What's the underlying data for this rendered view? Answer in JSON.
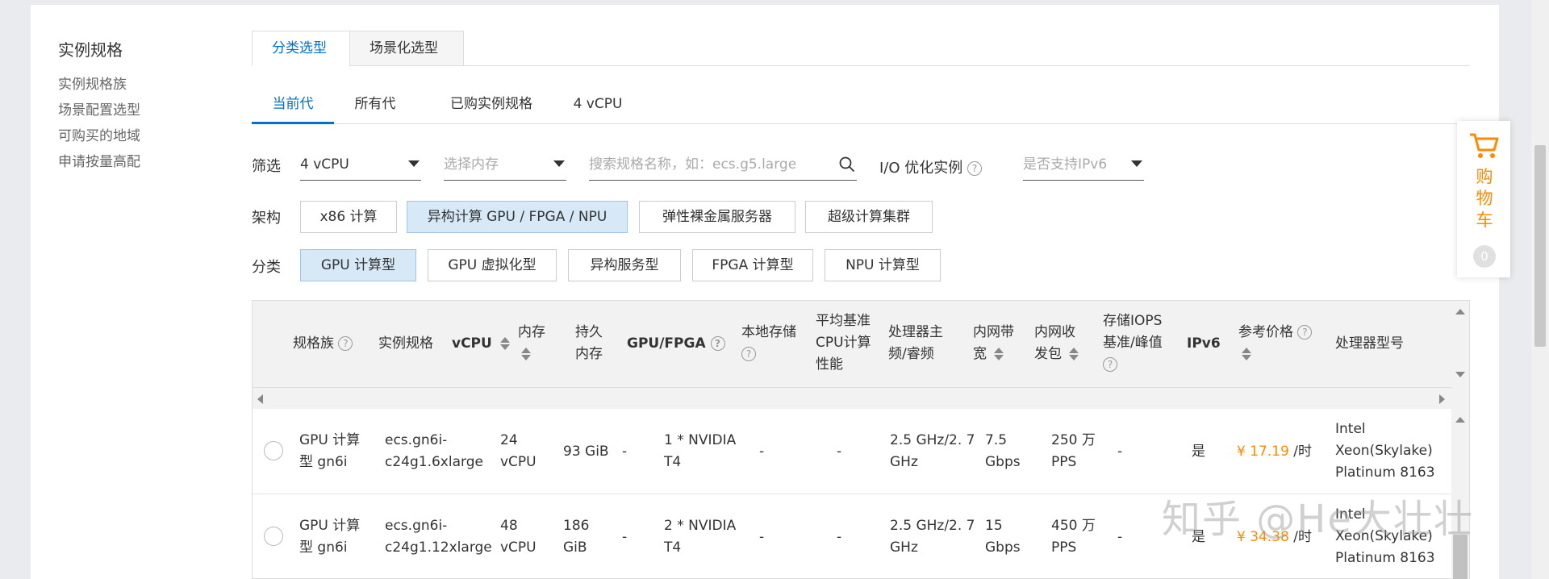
{
  "leftnav": {
    "title": "实例规格",
    "items": [
      "实例规格族",
      "场景配置选型",
      "可购买的地域",
      "申请按量高配"
    ]
  },
  "top_tabs": [
    "分类选型",
    "场景化选型"
  ],
  "gen_tabs": [
    "当前代",
    "所有代",
    "已购实例规格",
    "4 vCPU"
  ],
  "filter": {
    "label": "筛选",
    "vcpu_value": "4 vCPU",
    "memory_placeholder": "选择内存",
    "search_placeholder": "搜索规格名称，如：ecs.g5.large",
    "io_label": "I/O 优化实例",
    "ipv6_placeholder": "是否支持IPv6"
  },
  "arch": {
    "label": "架构",
    "options": [
      "x86 计算",
      "异构计算 GPU / FPGA / NPU",
      "弹性裸金属服务器",
      "超级计算集群"
    ]
  },
  "category": {
    "label": "分类",
    "options": [
      "GPU 计算型",
      "GPU 虚拟化型",
      "异构服务型",
      "FPGA 计算型",
      "NPU 计算型"
    ]
  },
  "table": {
    "headers": {
      "family": "规格族",
      "spec": "实例规格",
      "vcpu": "vCPU",
      "mem": "内存",
      "pmem": "持久\n内存",
      "gpu": "GPU/FPGA",
      "local": "本地存储",
      "cpu_perf": "平均基准\nCPU计算\n性能",
      "freq": "处理器主\n频/睿频",
      "bw": "内网带\n宽",
      "pps": "内网收\n发包",
      "iops": "存储IOPS\n基准/峰值",
      "ipv6": "IPv6",
      "price": "参考价格",
      "cpu_model": "处理器型号"
    },
    "rows": [
      {
        "family": "GPU 计算\n型 gn6i",
        "spec": "ecs.gn6i-\nc24g1.6xlarge",
        "vcpu": "24\nvCPU",
        "mem": "93 GiB",
        "pmem": "-",
        "gpu": "1 * NVIDIA\nT4",
        "local": "-",
        "cpu_perf": "-",
        "freq": "2.5 GHz/2. 7\nGHz",
        "bw": "7.5\nGbps",
        "pps": "250 万\nPPS",
        "iops": "-",
        "ipv6": "是",
        "price": "¥ 17.19",
        "price_unit": "/时",
        "cpu_model": "Intel\nXeon(Skylake)\nPlatinum 8163"
      },
      {
        "family": "GPU 计算\n型 gn6i",
        "spec": "ecs.gn6i-\nc24g1.12xlarge",
        "vcpu": "48\nvCPU",
        "mem": "186\nGiB",
        "pmem": "-",
        "gpu": "2 * NVIDIA\nT4",
        "local": "-",
        "cpu_perf": "-",
        "freq": "2.5 GHz/2. 7\nGHz",
        "bw": "15\nGbps",
        "pps": "450 万\nPPS",
        "iops": "-",
        "ipv6": "是",
        "price": "¥ 34.38",
        "price_unit": "/时",
        "cpu_model": "Intel\nXeon(Skylake)\nPlatinum 8163"
      }
    ]
  },
  "cart": {
    "label": "购\n物\n车",
    "count": "0"
  },
  "watermark": "知乎 @He大壮壮",
  "colors": {
    "accent": "#0070cc",
    "price": "#ff8a00",
    "active_option_bg": "#d7e8f6"
  }
}
